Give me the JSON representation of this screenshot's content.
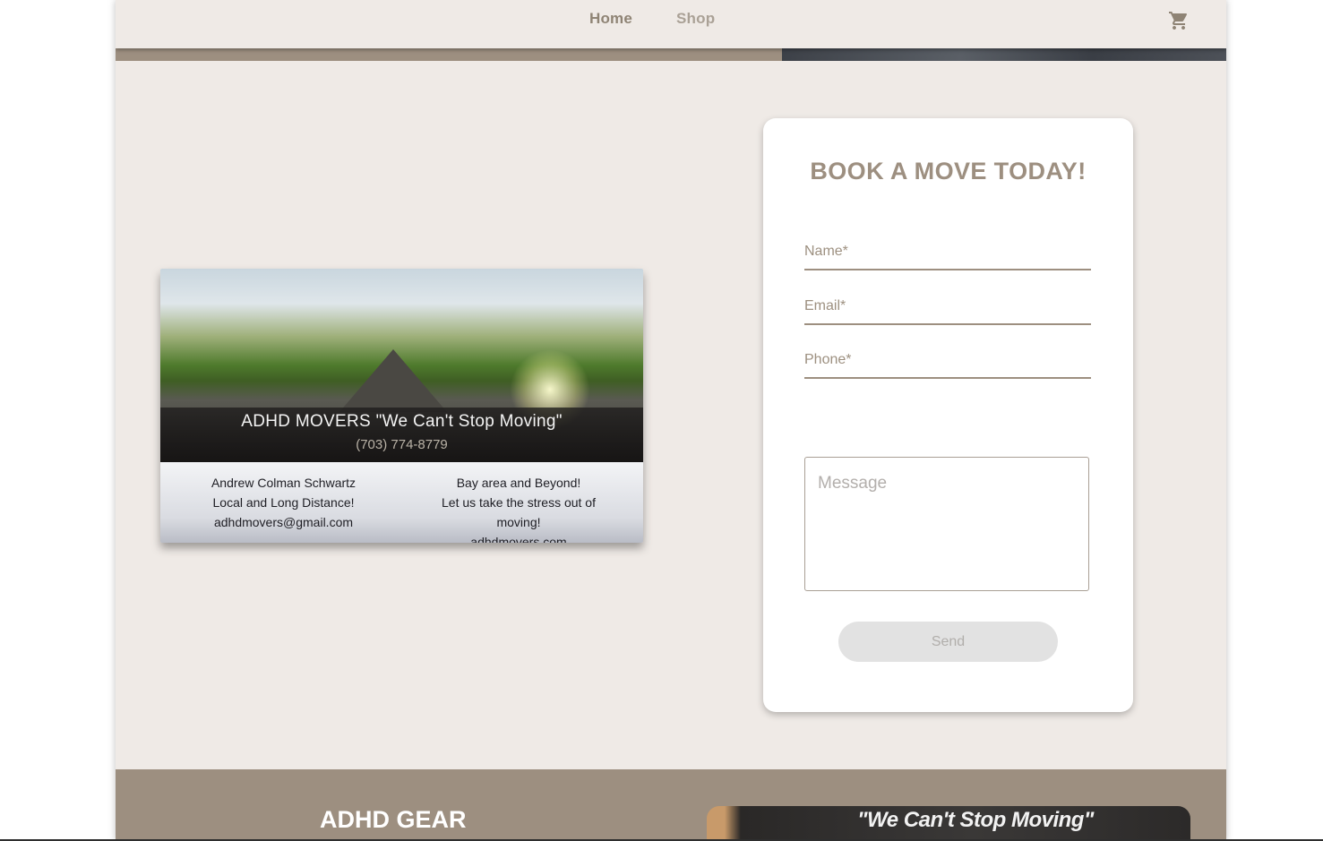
{
  "nav": {
    "home_label": "Home",
    "shop_label": "Shop",
    "cart_icon": "cart-icon"
  },
  "business_card": {
    "title": "ADHD MOVERS \"We Can't Stop Moving\"",
    "phone": "(703) 774-8779",
    "left_lines": [
      "Andrew Colman Schwartz",
      "Local and Long Distance!",
      "adhdmovers@gmail.com"
    ],
    "right_lines": [
      "Bay area and Beyond!",
      "Let us take the stress out of moving!",
      "adhdmovers.com"
    ]
  },
  "booking_form": {
    "title": "BOOK A MOVE TODAY!",
    "name_placeholder": "Name*",
    "email_placeholder": "Email*",
    "phone_placeholder": "Phone*",
    "message_placeholder": "Message",
    "send_label": "Send"
  },
  "gear": {
    "title": "ADHD GEAR",
    "shirt_text": "\"We Can't Stop Moving\""
  },
  "colors": {
    "page_bg": "#efeae6",
    "accent": "#9d8f80",
    "form_bg": "#ffffff",
    "button_disabled": "#e2e2e2"
  }
}
